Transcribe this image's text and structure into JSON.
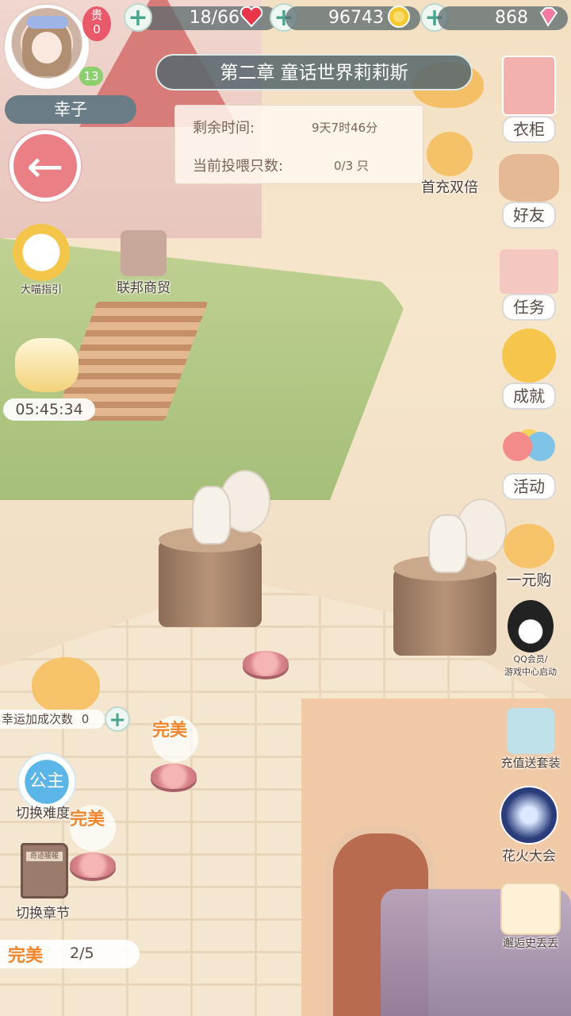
{
  "player": {
    "name": "幸子",
    "level": "13",
    "vip_label": "贵",
    "vip_level": "0"
  },
  "resources": {
    "stamina": "18/66",
    "coins": "96743",
    "gems": "868"
  },
  "chapter": {
    "title": "第二章 童话世界莉莉斯",
    "remaining_time_label": "剩余时间:",
    "remaining_time_value": "9天7时46分",
    "feed_label": "当前投喂只数:",
    "feed_value": "0/3 只"
  },
  "left_menu": {
    "guide_label": "大喵指引",
    "trade_label": "联邦商贸",
    "gift_timer": "05:45:34"
  },
  "right_menu": {
    "wardrobe": "衣柜",
    "first_recharge": "首充双倍",
    "friends": "好友",
    "tasks": "任务",
    "achievements": "成就",
    "events": "活动",
    "one_yuan": "一元购",
    "qq_vip_line1": "QQ会员/",
    "qq_vip_line2": "游戏中心启动",
    "recharge_outfit": "充值送套装",
    "fireworks": "花火大会",
    "encounter": "邂逅史丢丢"
  },
  "stage": {
    "perfect_label_1": "完美",
    "perfect_label_2": "完美",
    "luck_label": "幸运加成次数",
    "luck_count": "0",
    "difficulty_badge": "公主",
    "switch_difficulty": "切换难度",
    "book_title": "奇迹暖暖",
    "switch_chapter": "切换章节",
    "progress_label": "完美",
    "progress_value": "2/5"
  },
  "colors": {
    "accent_pink": "#ea7f85",
    "hud_bar": "#5a696e",
    "plus_green": "#4aa58e",
    "perfect_orange": "#f1852b"
  },
  "icons": {
    "stamina": "heart-icon",
    "coins": "gold-coin-icon",
    "gems": "pink-diamond-icon",
    "back": "arrow-left-icon"
  }
}
